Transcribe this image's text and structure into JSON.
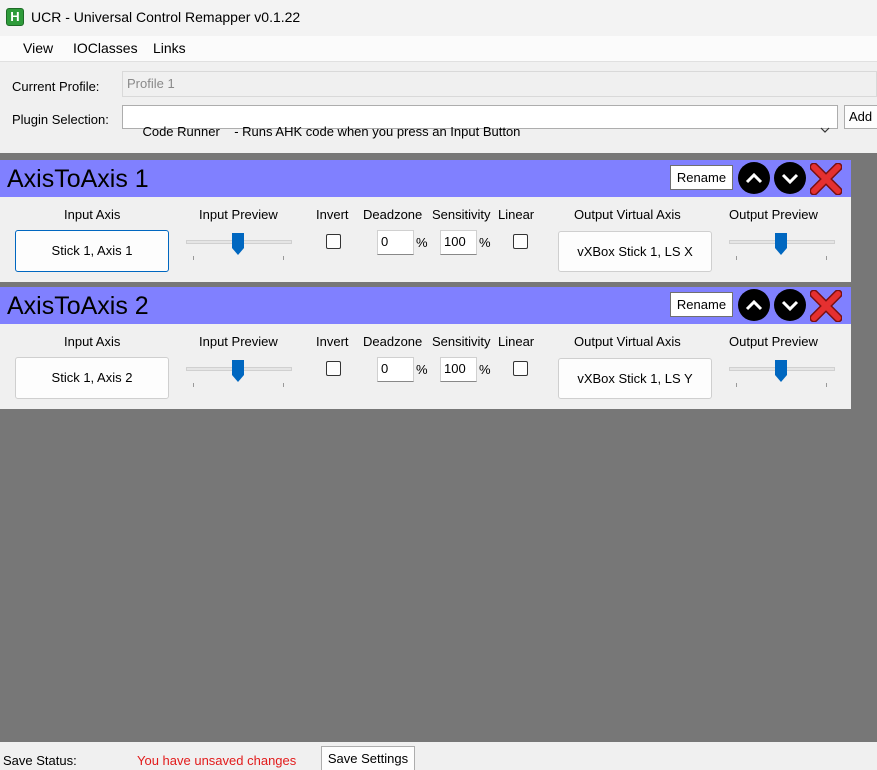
{
  "window": {
    "title": "UCR - Universal Control Remapper v0.1.22",
    "icon_letter": "H"
  },
  "menu": {
    "items": [
      "View",
      "IOClasses",
      "Links"
    ]
  },
  "profile": {
    "label": "Current Profile:",
    "value": "Profile 1"
  },
  "plugin_selection": {
    "label": "Plugin Selection:",
    "selected": "Code Runner    - Runs AHK code when you press an Input Button",
    "add_label": "Add"
  },
  "columns": {
    "input_axis": "Input Axis",
    "input_preview": "Input Preview",
    "invert": "Invert",
    "deadzone": "Deadzone",
    "sensitivity": "Sensitivity",
    "linear": "Linear",
    "output_virtual_axis": "Output Virtual Axis",
    "output_preview": "Output Preview",
    "percent": "%"
  },
  "plugins": [
    {
      "name": "AxisToAxis 1",
      "rename_label": "Rename",
      "input_axis": "Stick 1, Axis 1",
      "input_preview_level": 0.5,
      "invert": false,
      "deadzone": "0",
      "sensitivity": "100",
      "linear": false,
      "output_axis": "vXBox Stick 1, LS X",
      "output_preview_level": 0.5
    },
    {
      "name": "AxisToAxis 2",
      "rename_label": "Rename",
      "input_axis": "Stick 1, Axis 2",
      "input_preview_level": 0.5,
      "invert": false,
      "deadzone": "0",
      "sensitivity": "100",
      "linear": false,
      "output_axis": "vXBox Stick 1, LS Y",
      "output_preview_level": 0.5
    }
  ],
  "status": {
    "label": "Save Status:",
    "message": "You have unsaved changes",
    "save_button": "Save Settings"
  },
  "colors": {
    "plugin_header": "#8080ff",
    "workspace": "#777777",
    "unsaved_text": "#e21b1b",
    "slider_thumb": "#0067c0"
  }
}
